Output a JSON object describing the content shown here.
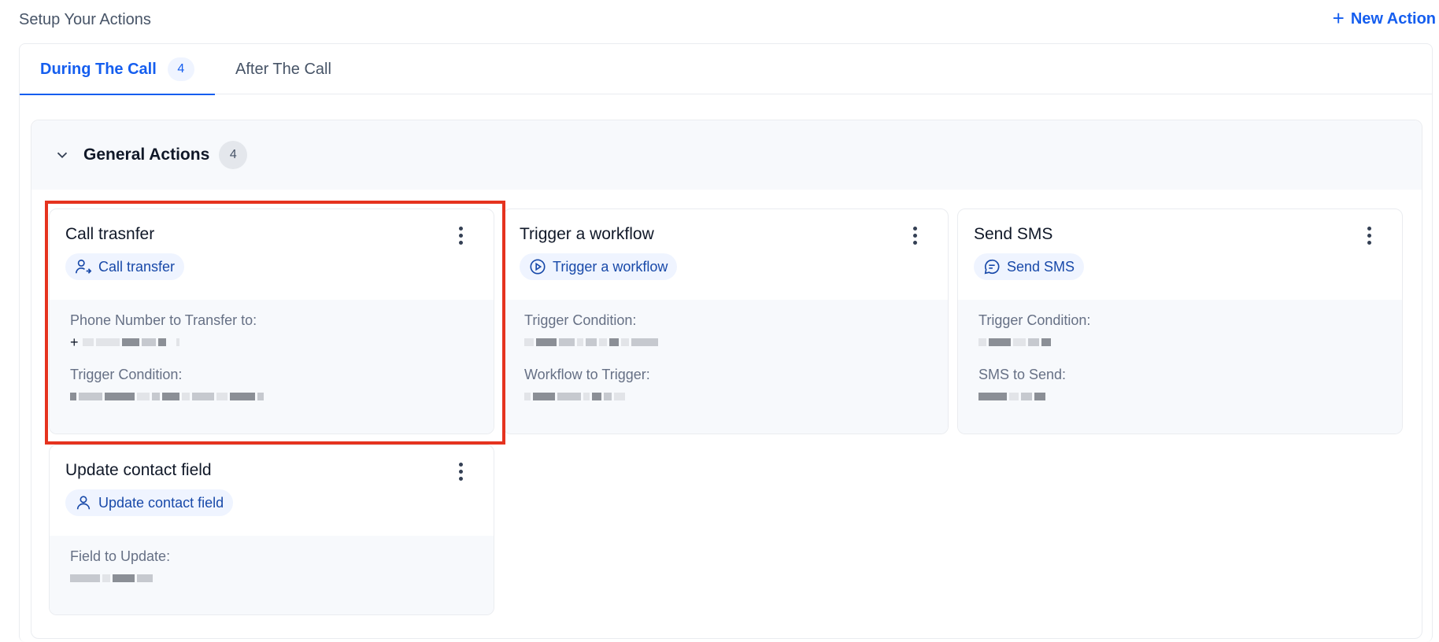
{
  "page": {
    "title": "Setup Your Actions",
    "new_action_label": "New Action"
  },
  "tabs": [
    {
      "label": "During The Call",
      "count": "4",
      "active": true
    },
    {
      "label": "After The Call",
      "active": false
    }
  ],
  "group": {
    "title": "General Actions",
    "count": "4"
  },
  "cards": [
    {
      "title": "Call trasnfer",
      "chip_label": "Call transfer",
      "chip_icon": "user-arrow-icon",
      "fields": [
        {
          "label": "Phone Number to Transfer to:",
          "value_prefix": "+"
        },
        {
          "label": "Trigger Condition:"
        }
      ]
    },
    {
      "title": "Trigger a workflow",
      "chip_label": "Trigger a workflow",
      "chip_icon": "play-circle-icon",
      "fields": [
        {
          "label": "Trigger Condition:"
        },
        {
          "label": "Workflow to Trigger:"
        }
      ]
    },
    {
      "title": "Send SMS",
      "chip_label": "Send SMS",
      "chip_icon": "message-icon",
      "fields": [
        {
          "label": "Trigger Condition:"
        },
        {
          "label": "SMS to Send:"
        }
      ]
    },
    {
      "title": "Update contact field",
      "chip_label": "Update contact field",
      "chip_icon": "user-icon",
      "fields": [
        {
          "label": "Field to Update:"
        }
      ]
    }
  ],
  "colors": {
    "accent": "#155eef",
    "chip_text": "#1849a9",
    "highlight": "#e5331f"
  }
}
